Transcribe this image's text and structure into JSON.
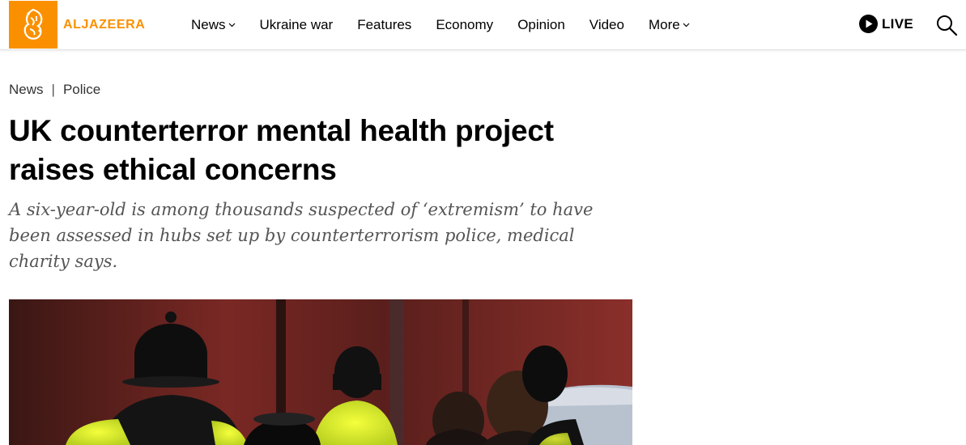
{
  "header": {
    "logo_text": "ALJAZEERA",
    "brand_color": "#fa9000",
    "nav": [
      {
        "label": "News",
        "has_dropdown": true
      },
      {
        "label": "Ukraine war",
        "has_dropdown": false
      },
      {
        "label": "Features",
        "has_dropdown": false
      },
      {
        "label": "Economy",
        "has_dropdown": false
      },
      {
        "label": "Opinion",
        "has_dropdown": false
      },
      {
        "label": "Video",
        "has_dropdown": false
      },
      {
        "label": "More",
        "has_dropdown": true
      }
    ],
    "live_label": "LIVE",
    "icons": {
      "live": "play-icon",
      "search": "search-icon",
      "dropdown": "chevron-down-icon"
    }
  },
  "article": {
    "breadcrumb": [
      "News",
      "Police"
    ],
    "title": "UK counterterror mental health project raises ethical concerns",
    "subtitle": "A six-year-old is among thousands suspected of ‘extremism’ to have been assessed in hubs set up by counterterrorism police, medical charity says."
  }
}
